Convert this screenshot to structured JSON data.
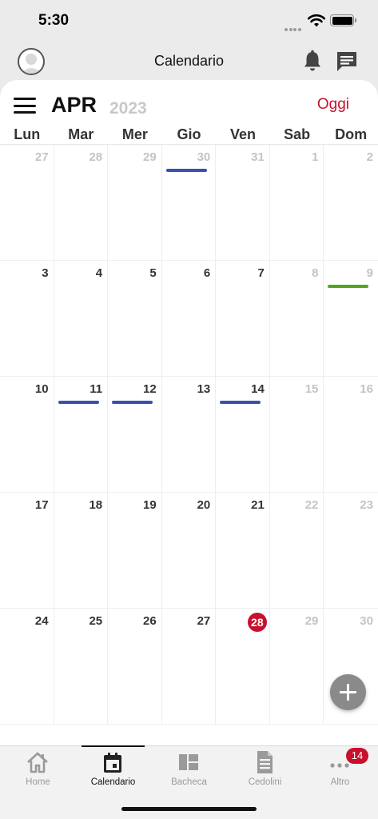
{
  "status": {
    "time": "5:30"
  },
  "header": {
    "title": "Calendario"
  },
  "calendar": {
    "month": "APR",
    "year": "2023",
    "today_label": "Oggi",
    "weekdays": [
      "Lun",
      "Mar",
      "Mer",
      "Gio",
      "Ven",
      "Sab",
      "Dom"
    ],
    "weeks": [
      [
        {
          "n": "27",
          "m": true
        },
        {
          "n": "28",
          "m": true
        },
        {
          "n": "29",
          "m": true
        },
        {
          "n": "30",
          "m": true,
          "e": "#3b4fae"
        },
        {
          "n": "31",
          "m": true
        },
        {
          "n": "1",
          "m": true
        },
        {
          "n": "2",
          "m": true
        }
      ],
      [
        {
          "n": "3"
        },
        {
          "n": "4"
        },
        {
          "n": "5"
        },
        {
          "n": "6"
        },
        {
          "n": "7"
        },
        {
          "n": "8",
          "m": true
        },
        {
          "n": "9",
          "m": true,
          "e": "#55a51c"
        }
      ],
      [
        {
          "n": "10"
        },
        {
          "n": "11",
          "e": "#3b4fae"
        },
        {
          "n": "12",
          "e": "#3b4fae"
        },
        {
          "n": "13"
        },
        {
          "n": "14",
          "e": "#3b4fae"
        },
        {
          "n": "15",
          "m": true
        },
        {
          "n": "16",
          "m": true
        }
      ],
      [
        {
          "n": "17"
        },
        {
          "n": "18"
        },
        {
          "n": "19"
        },
        {
          "n": "20"
        },
        {
          "n": "21"
        },
        {
          "n": "22",
          "m": true
        },
        {
          "n": "23",
          "m": true
        }
      ],
      [
        {
          "n": "24"
        },
        {
          "n": "25"
        },
        {
          "n": "26"
        },
        {
          "n": "27"
        },
        {
          "n": "28",
          "t": true
        },
        {
          "n": "29",
          "m": true
        },
        {
          "n": "30",
          "m": true
        }
      ]
    ]
  },
  "tabs": [
    {
      "label": "Home",
      "icon": "home-icon"
    },
    {
      "label": "Calendario",
      "icon": "calendar-icon",
      "active": true
    },
    {
      "label": "Bacheca",
      "icon": "board-icon"
    },
    {
      "label": "Cedolini",
      "icon": "document-icon"
    },
    {
      "label": "Altro",
      "icon": "more-icon"
    }
  ],
  "badge": {
    "count": "14"
  },
  "colors": {
    "accent": "#c8102e",
    "event_blue": "#3b4fae",
    "event_green": "#55a51c"
  }
}
